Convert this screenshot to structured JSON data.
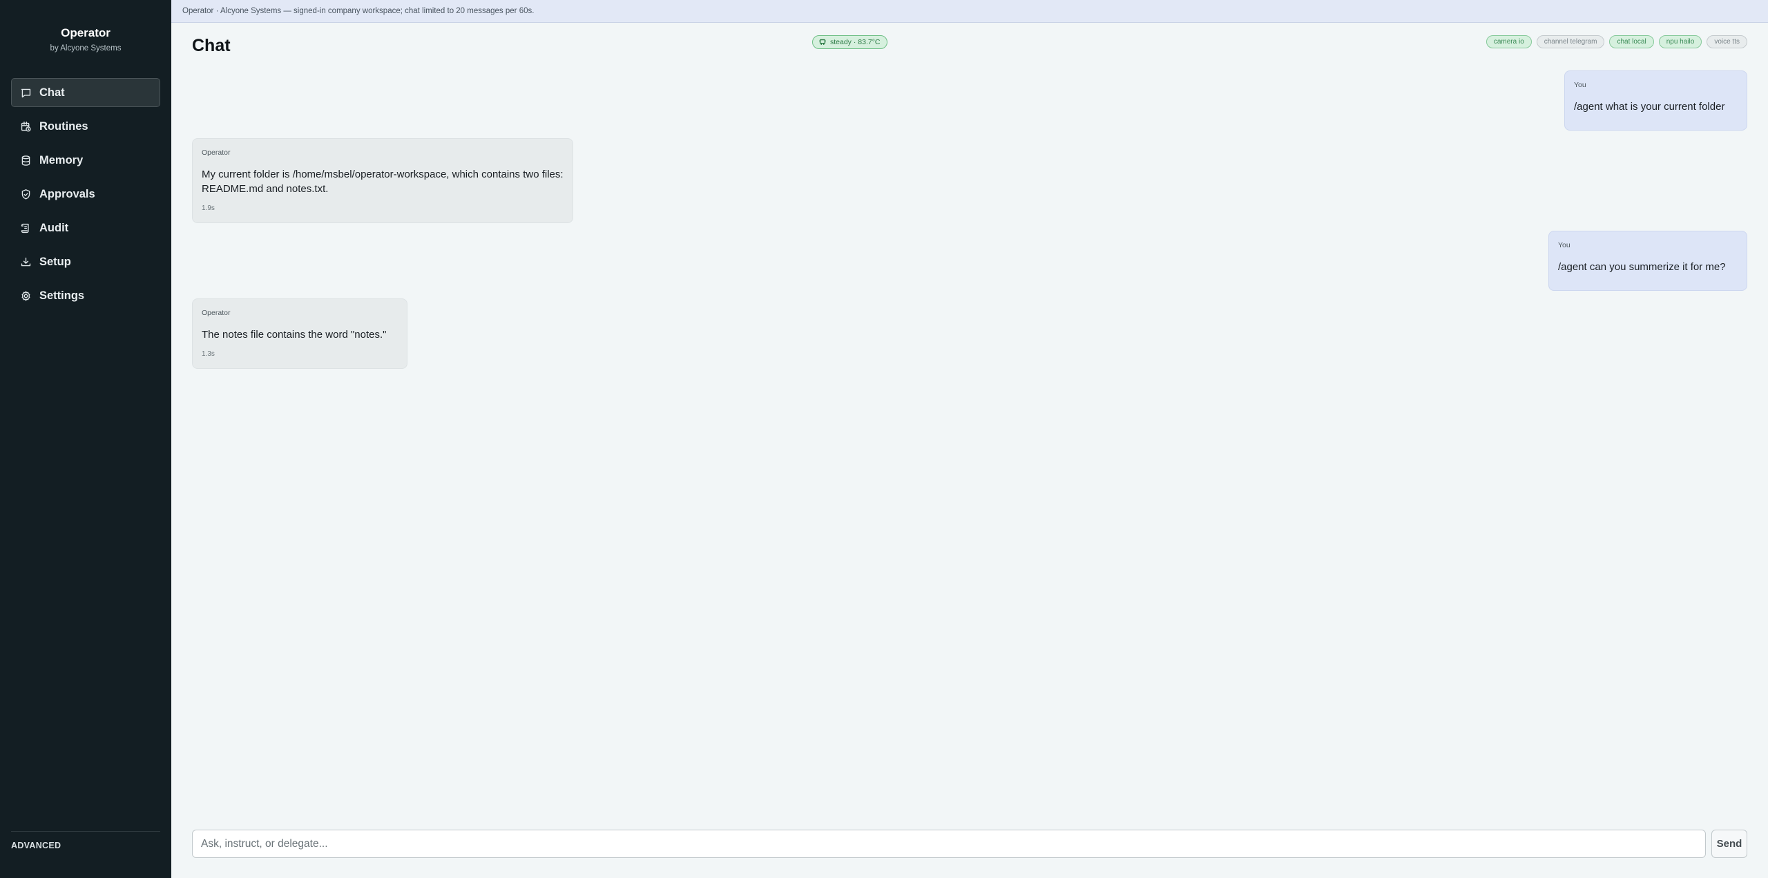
{
  "brand": {
    "name": "Operator",
    "subtitle": "by Alcyone Systems"
  },
  "sidebar": {
    "items": [
      {
        "label": "Chat",
        "icon": "chat-bubble-icon",
        "active": true
      },
      {
        "label": "Routines",
        "icon": "calendar-clock-icon",
        "active": false
      },
      {
        "label": "Memory",
        "icon": "database-icon",
        "active": false
      },
      {
        "label": "Approvals",
        "icon": "shield-check-icon",
        "active": false
      },
      {
        "label": "Audit",
        "icon": "scroll-icon",
        "active": false
      },
      {
        "label": "Setup",
        "icon": "download-icon",
        "active": false
      },
      {
        "label": "Settings",
        "icon": "gear-icon",
        "active": false
      }
    ],
    "footer_label": "ADVANCED"
  },
  "banner": {
    "text": "Operator · Alcyone Systems — signed-in company workspace; chat limited to 20 messages per 60s."
  },
  "header": {
    "title": "Chat",
    "status": {
      "text": "steady · 83.7°C",
      "icon": "chip-icon",
      "color": "#2c7a45"
    },
    "chips": [
      {
        "label": "camera io",
        "state": "on"
      },
      {
        "label": "channel telegram",
        "state": "off"
      },
      {
        "label": "chat local",
        "state": "on"
      },
      {
        "label": "npu hailo",
        "state": "on"
      },
      {
        "label": "voice tts",
        "state": "off"
      }
    ]
  },
  "messages": [
    {
      "author": "You",
      "role": "user",
      "text": "/agent what is your current folder"
    },
    {
      "author": "Operator",
      "role": "bot",
      "text": "My current folder is /home/msbel/operator-workspace, which contains two files: README.md and notes.txt.",
      "time": "1.9s"
    },
    {
      "author": "You",
      "role": "user",
      "text": "/agent can you summerize it for me?"
    },
    {
      "author": "Operator",
      "role": "bot",
      "text": "The notes file contains the word \"notes.\"",
      "time": "1.3s"
    }
  ],
  "composer": {
    "placeholder": "Ask, instruct, or delegate...",
    "value": "",
    "send_label": "Send"
  },
  "colors": {
    "sidebar_bg": "#131e23",
    "main_bg": "#f2f6f7",
    "user_bubble": "#dde5f7",
    "bot_bubble": "#e7ebec",
    "accent_green": "#2c7a45"
  }
}
